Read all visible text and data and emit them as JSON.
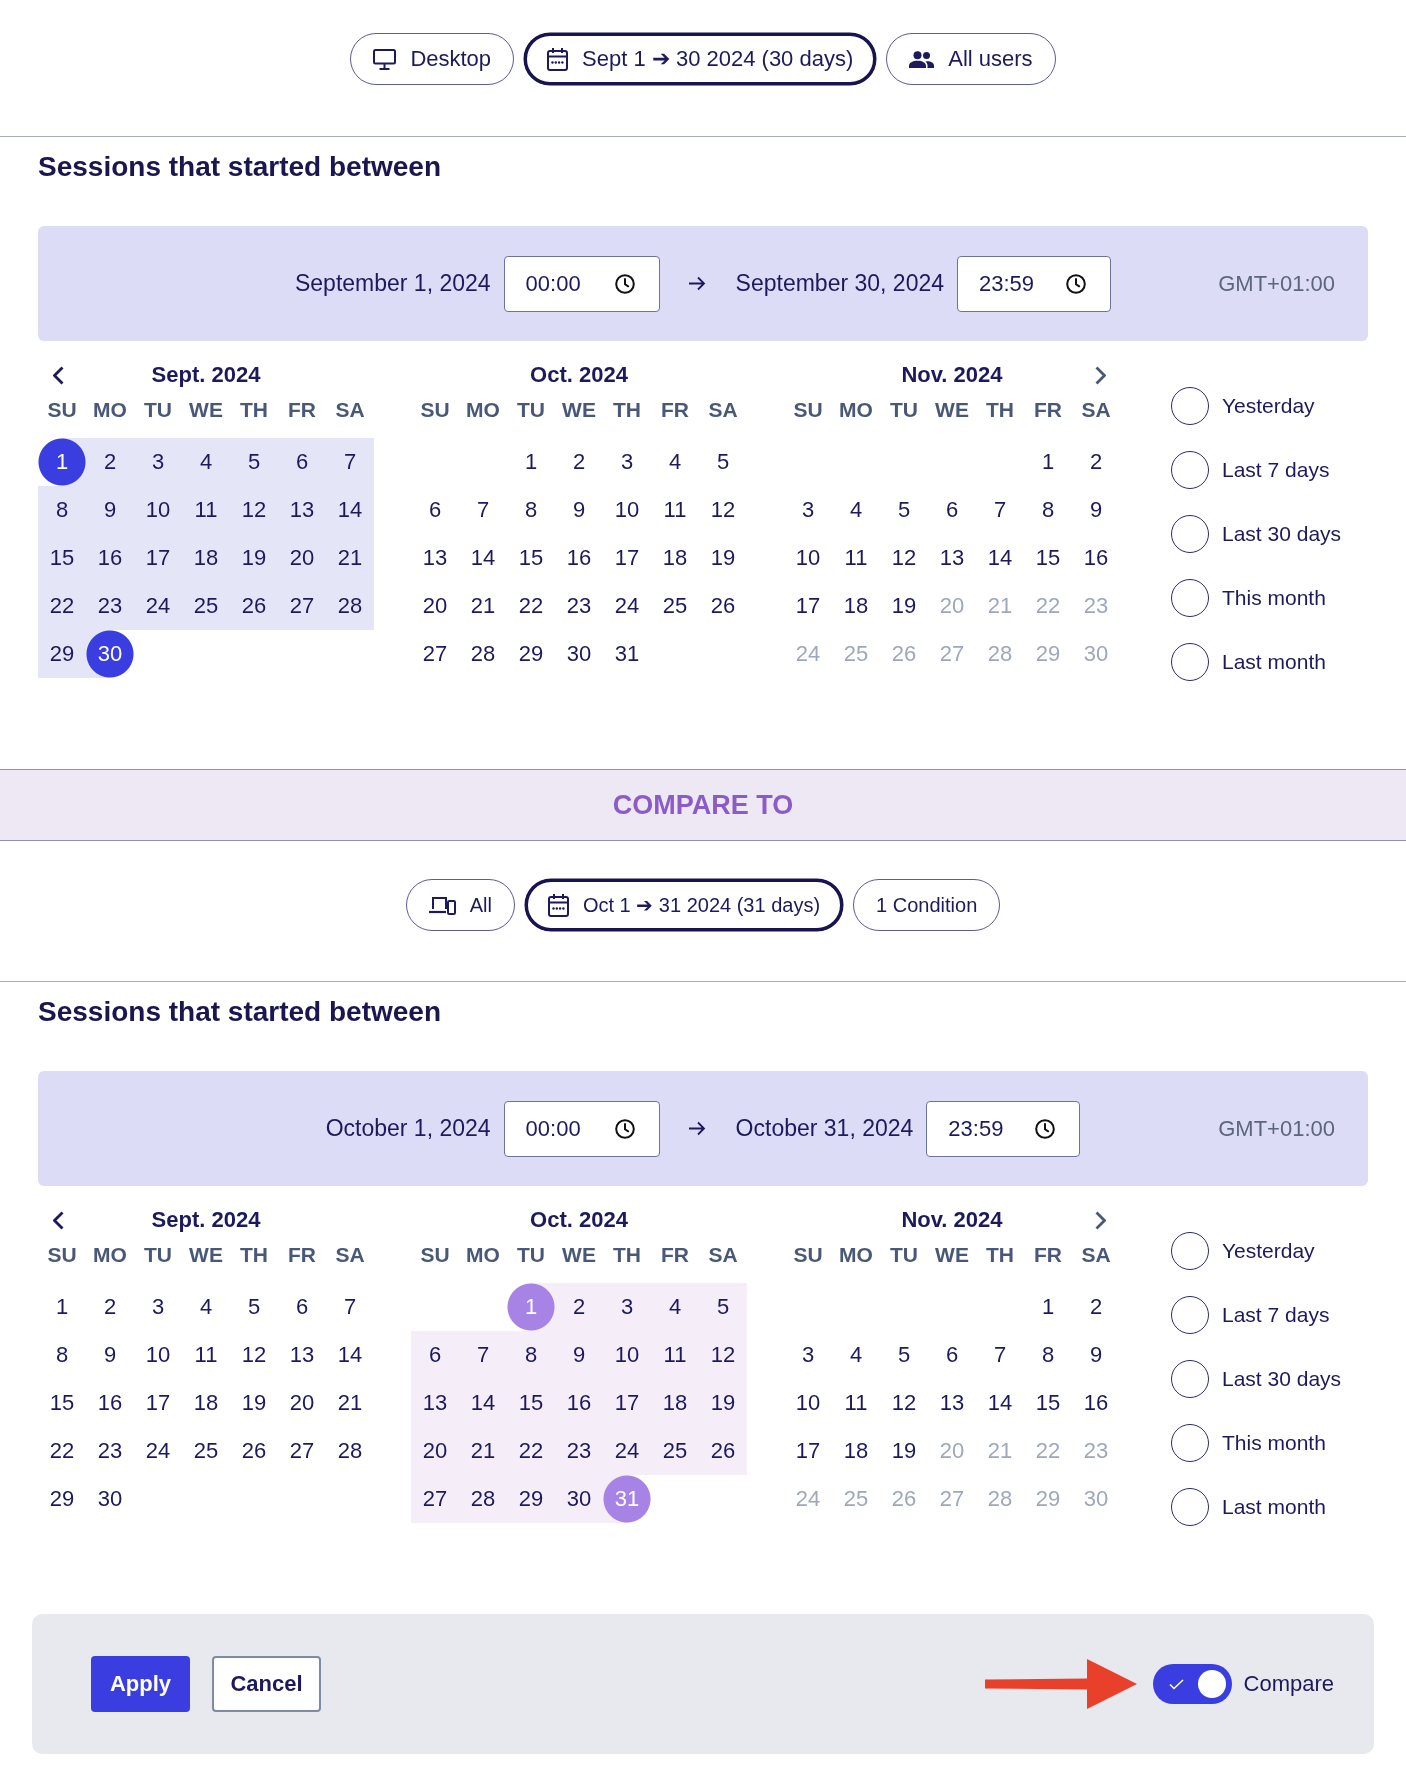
{
  "filters": [
    {
      "kind": "desktop",
      "label": "Desktop",
      "selected": false
    },
    {
      "kind": "date",
      "label": "Sept 1 ➔ 30 2024 (30 days)",
      "selected": true
    },
    {
      "kind": "users",
      "label": "All users",
      "selected": false
    }
  ],
  "period": {
    "kind": "primary",
    "heading": "Sessions that started between",
    "start_date": "September 1, 2024",
    "start_time": "00:00",
    "end_date": "September 30, 2024",
    "end_time": "23:59",
    "timezone": "GMT+01:00",
    "months": [
      {
        "title": "Sept. 2024",
        "weekdays": [
          "SU",
          "MO",
          "TU",
          "WE",
          "TH",
          "FR",
          "SA"
        ],
        "weeks": [
          [
            {
              "day": "1",
              "selected": true,
              "in_range": true,
              "disabled": false
            },
            {
              "day": "2",
              "selected": false,
              "in_range": true,
              "disabled": false
            },
            {
              "day": "3",
              "selected": false,
              "in_range": true,
              "disabled": false
            },
            {
              "day": "4",
              "selected": false,
              "in_range": true,
              "disabled": false
            },
            {
              "day": "5",
              "selected": false,
              "in_range": true,
              "disabled": false
            },
            {
              "day": "6",
              "selected": false,
              "in_range": true,
              "disabled": false
            },
            {
              "day": "7",
              "selected": false,
              "in_range": true,
              "disabled": false
            }
          ],
          [
            {
              "day": "8",
              "selected": false,
              "in_range": true,
              "disabled": false
            },
            {
              "day": "9",
              "selected": false,
              "in_range": true,
              "disabled": false
            },
            {
              "day": "10",
              "selected": false,
              "in_range": true,
              "disabled": false
            },
            {
              "day": "11",
              "selected": false,
              "in_range": true,
              "disabled": false
            },
            {
              "day": "12",
              "selected": false,
              "in_range": true,
              "disabled": false
            },
            {
              "day": "13",
              "selected": false,
              "in_range": true,
              "disabled": false
            },
            {
              "day": "14",
              "selected": false,
              "in_range": true,
              "disabled": false
            }
          ],
          [
            {
              "day": "15",
              "selected": false,
              "in_range": true,
              "disabled": false
            },
            {
              "day": "16",
              "selected": false,
              "in_range": true,
              "disabled": false
            },
            {
              "day": "17",
              "selected": false,
              "in_range": true,
              "disabled": false
            },
            {
              "day": "18",
              "selected": false,
              "in_range": true,
              "disabled": false
            },
            {
              "day": "19",
              "selected": false,
              "in_range": true,
              "disabled": false
            },
            {
              "day": "20",
              "selected": false,
              "in_range": true,
              "disabled": false
            },
            {
              "day": "21",
              "selected": false,
              "in_range": true,
              "disabled": false
            }
          ],
          [
            {
              "day": "22",
              "selected": false,
              "in_range": true,
              "disabled": false
            },
            {
              "day": "23",
              "selected": false,
              "in_range": true,
              "disabled": false
            },
            {
              "day": "24",
              "selected": false,
              "in_range": true,
              "disabled": false
            },
            {
              "day": "25",
              "selected": false,
              "in_range": true,
              "disabled": false
            },
            {
              "day": "26",
              "selected": false,
              "in_range": true,
              "disabled": false
            },
            {
              "day": "27",
              "selected": false,
              "in_range": true,
              "disabled": false
            },
            {
              "day": "28",
              "selected": false,
              "in_range": true,
              "disabled": false
            }
          ],
          [
            {
              "day": "29",
              "selected": false,
              "in_range": true,
              "disabled": false
            },
            {
              "day": "30",
              "selected": true,
              "in_range": true,
              "disabled": false
            }
          ]
        ]
      },
      {
        "title": "Oct. 2024",
        "weekdays": [
          "SU",
          "MO",
          "TU",
          "WE",
          "TH",
          "FR",
          "SA"
        ],
        "weeks": [
          [
            {
              "day": "1",
              "selected": false,
              "in_range": false,
              "disabled": false
            },
            {
              "day": "2",
              "selected": false,
              "in_range": false,
              "disabled": false
            },
            {
              "day": "3",
              "selected": false,
              "in_range": false,
              "disabled": false
            },
            {
              "day": "4",
              "selected": false,
              "in_range": false,
              "disabled": false
            },
            {
              "day": "5",
              "selected": false,
              "in_range": false,
              "disabled": false
            }
          ],
          [
            {
              "day": "6",
              "selected": false,
              "in_range": false,
              "disabled": false
            },
            {
              "day": "7",
              "selected": false,
              "in_range": false,
              "disabled": false
            },
            {
              "day": "8",
              "selected": false,
              "in_range": false,
              "disabled": false
            },
            {
              "day": "9",
              "selected": false,
              "in_range": false,
              "disabled": false
            },
            {
              "day": "10",
              "selected": false,
              "in_range": false,
              "disabled": false
            },
            {
              "day": "11",
              "selected": false,
              "in_range": false,
              "disabled": false
            },
            {
              "day": "12",
              "selected": false,
              "in_range": false,
              "disabled": false
            }
          ],
          [
            {
              "day": "13",
              "selected": false,
              "in_range": false,
              "disabled": false
            },
            {
              "day": "14",
              "selected": false,
              "in_range": false,
              "disabled": false
            },
            {
              "day": "15",
              "selected": false,
              "in_range": false,
              "disabled": false
            },
            {
              "day": "16",
              "selected": false,
              "in_range": false,
              "disabled": false
            },
            {
              "day": "17",
              "selected": false,
              "in_range": false,
              "disabled": false
            },
            {
              "day": "18",
              "selected": false,
              "in_range": false,
              "disabled": false
            },
            {
              "day": "19",
              "selected": false,
              "in_range": false,
              "disabled": false
            }
          ],
          [
            {
              "day": "20",
              "selected": false,
              "in_range": false,
              "disabled": false
            },
            {
              "day": "21",
              "selected": false,
              "in_range": false,
              "disabled": false
            },
            {
              "day": "22",
              "selected": false,
              "in_range": false,
              "disabled": false
            },
            {
              "day": "23",
              "selected": false,
              "in_range": false,
              "disabled": false
            },
            {
              "day": "24",
              "selected": false,
              "in_range": false,
              "disabled": false
            },
            {
              "day": "25",
              "selected": false,
              "in_range": false,
              "disabled": false
            },
            {
              "day": "26",
              "selected": false,
              "in_range": false,
              "disabled": false
            }
          ],
          [
            {
              "day": "27",
              "selected": false,
              "in_range": false,
              "disabled": false
            },
            {
              "day": "28",
              "selected": false,
              "in_range": false,
              "disabled": false
            },
            {
              "day": "29",
              "selected": false,
              "in_range": false,
              "disabled": false
            },
            {
              "day": "30",
              "selected": false,
              "in_range": false,
              "disabled": false
            },
            {
              "day": "31",
              "selected": false,
              "in_range": false,
              "disabled": false
            }
          ]
        ]
      },
      {
        "title": "Nov. 2024",
        "weekdays": [
          "SU",
          "MO",
          "TU",
          "WE",
          "TH",
          "FR",
          "SA"
        ],
        "weeks": [
          [
            {
              "day": "1",
              "selected": false,
              "in_range": false,
              "disabled": false
            },
            {
              "day": "2",
              "selected": false,
              "in_range": false,
              "disabled": false
            }
          ],
          [
            {
              "day": "3",
              "selected": false,
              "in_range": false,
              "disabled": false
            },
            {
              "day": "4",
              "selected": false,
              "in_range": false,
              "disabled": false
            },
            {
              "day": "5",
              "selected": false,
              "in_range": false,
              "disabled": false
            },
            {
              "day": "6",
              "selected": false,
              "in_range": false,
              "disabled": false
            },
            {
              "day": "7",
              "selected": false,
              "in_range": false,
              "disabled": false
            },
            {
              "day": "8",
              "selected": false,
              "in_range": false,
              "disabled": false
            },
            {
              "day": "9",
              "selected": false,
              "in_range": false,
              "disabled": false
            }
          ],
          [
            {
              "day": "10",
              "selected": false,
              "in_range": false,
              "disabled": false
            },
            {
              "day": "11",
              "selected": false,
              "in_range": false,
              "disabled": false
            },
            {
              "day": "12",
              "selected": false,
              "in_range": false,
              "disabled": false
            },
            {
              "day": "13",
              "selected": false,
              "in_range": false,
              "disabled": false
            },
            {
              "day": "14",
              "selected": false,
              "in_range": false,
              "disabled": false
            },
            {
              "day": "15",
              "selected": false,
              "in_range": false,
              "disabled": false
            },
            {
              "day": "16",
              "selected": false,
              "in_range": false,
              "disabled": false
            }
          ],
          [
            {
              "day": "17",
              "selected": false,
              "in_range": false,
              "disabled": false
            },
            {
              "day": "18",
              "selected": false,
              "in_range": false,
              "disabled": false
            },
            {
              "day": "19",
              "selected": false,
              "in_range": false,
              "disabled": false
            },
            {
              "day": "20",
              "selected": false,
              "in_range": false,
              "disabled": true
            },
            {
              "day": "21",
              "selected": false,
              "in_range": false,
              "disabled": true
            },
            {
              "day": "22",
              "selected": false,
              "in_range": false,
              "disabled": true
            },
            {
              "day": "23",
              "selected": false,
              "in_range": false,
              "disabled": true
            }
          ],
          [
            {
              "day": "24",
              "selected": false,
              "in_range": false,
              "disabled": true
            },
            {
              "day": "25",
              "selected": false,
              "in_range": false,
              "disabled": true
            },
            {
              "day": "26",
              "selected": false,
              "in_range": false,
              "disabled": true
            },
            {
              "day": "27",
              "selected": false,
              "in_range": false,
              "disabled": true
            },
            {
              "day": "28",
              "selected": false,
              "in_range": false,
              "disabled": true
            },
            {
              "day": "29",
              "selected": false,
              "in_range": false,
              "disabled": true
            },
            {
              "day": "30",
              "selected": false,
              "in_range": false,
              "disabled": true
            }
          ]
        ]
      }
    ],
    "presets": [
      {
        "label": "Yesterday",
        "selected": false
      },
      {
        "label": "Last 7 days",
        "selected": false
      },
      {
        "label": "Last 30 days",
        "selected": false
      },
      {
        "label": "This month",
        "selected": false
      },
      {
        "label": "Last month",
        "selected": false
      }
    ]
  },
  "compare_banner": {
    "title": "COMPARE TO"
  },
  "compare_filters": [
    {
      "kind": "devices",
      "label": "All",
      "selected": false
    },
    {
      "kind": "date",
      "label": "Oct 1 ➔ 31 2024 (31 days)",
      "selected": true
    },
    {
      "kind": "condition",
      "label": "1 Condition",
      "selected": false
    }
  ],
  "compare_period": {
    "kind": "compare",
    "heading": "Sessions that started between",
    "start_date": "October 1, 2024",
    "start_time": "00:00",
    "end_date": "October 31, 2024",
    "end_time": "23:59",
    "timezone": "GMT+01:00",
    "months": [
      {
        "title": "Sept. 2024",
        "weekdays": [
          "SU",
          "MO",
          "TU",
          "WE",
          "TH",
          "FR",
          "SA"
        ],
        "weeks": [
          [
            {
              "day": "1",
              "selected": false,
              "in_range": false,
              "disabled": false
            },
            {
              "day": "2",
              "selected": false,
              "in_range": false,
              "disabled": false
            },
            {
              "day": "3",
              "selected": false,
              "in_range": false,
              "disabled": false
            },
            {
              "day": "4",
              "selected": false,
              "in_range": false,
              "disabled": false
            },
            {
              "day": "5",
              "selected": false,
              "in_range": false,
              "disabled": false
            },
            {
              "day": "6",
              "selected": false,
              "in_range": false,
              "disabled": false
            },
            {
              "day": "7",
              "selected": false,
              "in_range": false,
              "disabled": false
            }
          ],
          [
            {
              "day": "8",
              "selected": false,
              "in_range": false,
              "disabled": false
            },
            {
              "day": "9",
              "selected": false,
              "in_range": false,
              "disabled": false
            },
            {
              "day": "10",
              "selected": false,
              "in_range": false,
              "disabled": false
            },
            {
              "day": "11",
              "selected": false,
              "in_range": false,
              "disabled": false
            },
            {
              "day": "12",
              "selected": false,
              "in_range": false,
              "disabled": false
            },
            {
              "day": "13",
              "selected": false,
              "in_range": false,
              "disabled": false
            },
            {
              "day": "14",
              "selected": false,
              "in_range": false,
              "disabled": false
            }
          ],
          [
            {
              "day": "15",
              "selected": false,
              "in_range": false,
              "disabled": false
            },
            {
              "day": "16",
              "selected": false,
              "in_range": false,
              "disabled": false
            },
            {
              "day": "17",
              "selected": false,
              "in_range": false,
              "disabled": false
            },
            {
              "day": "18",
              "selected": false,
              "in_range": false,
              "disabled": false
            },
            {
              "day": "19",
              "selected": false,
              "in_range": false,
              "disabled": false
            },
            {
              "day": "20",
              "selected": false,
              "in_range": false,
              "disabled": false
            },
            {
              "day": "21",
              "selected": false,
              "in_range": false,
              "disabled": false
            }
          ],
          [
            {
              "day": "22",
              "selected": false,
              "in_range": false,
              "disabled": false
            },
            {
              "day": "23",
              "selected": false,
              "in_range": false,
              "disabled": false
            },
            {
              "day": "24",
              "selected": false,
              "in_range": false,
              "disabled": false
            },
            {
              "day": "25",
              "selected": false,
              "in_range": false,
              "disabled": false
            },
            {
              "day": "26",
              "selected": false,
              "in_range": false,
              "disabled": false
            },
            {
              "day": "27",
              "selected": false,
              "in_range": false,
              "disabled": false
            },
            {
              "day": "28",
              "selected": false,
              "in_range": false,
              "disabled": false
            }
          ],
          [
            {
              "day": "29",
              "selected": false,
              "in_range": false,
              "disabled": false
            },
            {
              "day": "30",
              "selected": false,
              "in_range": false,
              "disabled": false
            }
          ]
        ]
      },
      {
        "title": "Oct. 2024",
        "weekdays": [
          "SU",
          "MO",
          "TU",
          "WE",
          "TH",
          "FR",
          "SA"
        ],
        "weeks": [
          [
            {
              "day": "1",
              "selected": true,
              "in_range": true,
              "disabled": false
            },
            {
              "day": "2",
              "selected": false,
              "in_range": true,
              "disabled": false
            },
            {
              "day": "3",
              "selected": false,
              "in_range": true,
              "disabled": false
            },
            {
              "day": "4",
              "selected": false,
              "in_range": true,
              "disabled": false
            },
            {
              "day": "5",
              "selected": false,
              "in_range": true,
              "disabled": false
            }
          ],
          [
            {
              "day": "6",
              "selected": false,
              "in_range": true,
              "disabled": false
            },
            {
              "day": "7",
              "selected": false,
              "in_range": true,
              "disabled": false
            },
            {
              "day": "8",
              "selected": false,
              "in_range": true,
              "disabled": false
            },
            {
              "day": "9",
              "selected": false,
              "in_range": true,
              "disabled": false
            },
            {
              "day": "10",
              "selected": false,
              "in_range": true,
              "disabled": false
            },
            {
              "day": "11",
              "selected": false,
              "in_range": true,
              "disabled": false
            },
            {
              "day": "12",
              "selected": false,
              "in_range": true,
              "disabled": false
            }
          ],
          [
            {
              "day": "13",
              "selected": false,
              "in_range": true,
              "disabled": false
            },
            {
              "day": "14",
              "selected": false,
              "in_range": true,
              "disabled": false
            },
            {
              "day": "15",
              "selected": false,
              "in_range": true,
              "disabled": false
            },
            {
              "day": "16",
              "selected": false,
              "in_range": true,
              "disabled": false
            },
            {
              "day": "17",
              "selected": false,
              "in_range": true,
              "disabled": false
            },
            {
              "day": "18",
              "selected": false,
              "in_range": true,
              "disabled": false
            },
            {
              "day": "19",
              "selected": false,
              "in_range": true,
              "disabled": false
            }
          ],
          [
            {
              "day": "20",
              "selected": false,
              "in_range": true,
              "disabled": false
            },
            {
              "day": "21",
              "selected": false,
              "in_range": true,
              "disabled": false
            },
            {
              "day": "22",
              "selected": false,
              "in_range": true,
              "disabled": false
            },
            {
              "day": "23",
              "selected": false,
              "in_range": true,
              "disabled": false
            },
            {
              "day": "24",
              "selected": false,
              "in_range": true,
              "disabled": false
            },
            {
              "day": "25",
              "selected": false,
              "in_range": true,
              "disabled": false
            },
            {
              "day": "26",
              "selected": false,
              "in_range": true,
              "disabled": false
            }
          ],
          [
            {
              "day": "27",
              "selected": false,
              "in_range": true,
              "disabled": false
            },
            {
              "day": "28",
              "selected": false,
              "in_range": true,
              "disabled": false
            },
            {
              "day": "29",
              "selected": false,
              "in_range": true,
              "disabled": false
            },
            {
              "day": "30",
              "selected": false,
              "in_range": true,
              "disabled": false
            },
            {
              "day": "31",
              "selected": true,
              "in_range": true,
              "disabled": false
            }
          ]
        ]
      },
      {
        "title": "Nov. 2024",
        "weekdays": [
          "SU",
          "MO",
          "TU",
          "WE",
          "TH",
          "FR",
          "SA"
        ],
        "weeks": [
          [
            {
              "day": "1",
              "selected": false,
              "in_range": false,
              "disabled": false
            },
            {
              "day": "2",
              "selected": false,
              "in_range": false,
              "disabled": false
            }
          ],
          [
            {
              "day": "3",
              "selected": false,
              "in_range": false,
              "disabled": false
            },
            {
              "day": "4",
              "selected": false,
              "in_range": false,
              "disabled": false
            },
            {
              "day": "5",
              "selected": false,
              "in_range": false,
              "disabled": false
            },
            {
              "day": "6",
              "selected": false,
              "in_range": false,
              "disabled": false
            },
            {
              "day": "7",
              "selected": false,
              "in_range": false,
              "disabled": false
            },
            {
              "day": "8",
              "selected": false,
              "in_range": false,
              "disabled": false
            },
            {
              "day": "9",
              "selected": false,
              "in_range": false,
              "disabled": false
            }
          ],
          [
            {
              "day": "10",
              "selected": false,
              "in_range": false,
              "disabled": false
            },
            {
              "day": "11",
              "selected": false,
              "in_range": false,
              "disabled": false
            },
            {
              "day": "12",
              "selected": false,
              "in_range": false,
              "disabled": false
            },
            {
              "day": "13",
              "selected": false,
              "in_range": false,
              "disabled": false
            },
            {
              "day": "14",
              "selected": false,
              "in_range": false,
              "disabled": false
            },
            {
              "day": "15",
              "selected": false,
              "in_range": false,
              "disabled": false
            },
            {
              "day": "16",
              "selected": false,
              "in_range": false,
              "disabled": false
            }
          ],
          [
            {
              "day": "17",
              "selected": false,
              "in_range": false,
              "disabled": false
            },
            {
              "day": "18",
              "selected": false,
              "in_range": false,
              "disabled": false
            },
            {
              "day": "19",
              "selected": false,
              "in_range": false,
              "disabled": false
            },
            {
              "day": "20",
              "selected": false,
              "in_range": false,
              "disabled": true
            },
            {
              "day": "21",
              "selected": false,
              "in_range": false,
              "disabled": true
            },
            {
              "day": "22",
              "selected": false,
              "in_range": false,
              "disabled": true
            },
            {
              "day": "23",
              "selected": false,
              "in_range": false,
              "disabled": true
            }
          ],
          [
            {
              "day": "24",
              "selected": false,
              "in_range": false,
              "disabled": true
            },
            {
              "day": "25",
              "selected": false,
              "in_range": false,
              "disabled": true
            },
            {
              "day": "26",
              "selected": false,
              "in_range": false,
              "disabled": true
            },
            {
              "day": "27",
              "selected": false,
              "in_range": false,
              "disabled": true
            },
            {
              "day": "28",
              "selected": false,
              "in_range": false,
              "disabled": true
            },
            {
              "day": "29",
              "selected": false,
              "in_range": false,
              "disabled": true
            },
            {
              "day": "30",
              "selected": false,
              "in_range": false,
              "disabled": true
            }
          ]
        ]
      }
    ],
    "presets": [
      {
        "label": "Yesterday",
        "selected": false
      },
      {
        "label": "Last 7 days",
        "selected": false
      },
      {
        "label": "Last 30 days",
        "selected": false
      },
      {
        "label": "This month",
        "selected": false
      },
      {
        "label": "Last month",
        "selected": false
      }
    ]
  },
  "footer": {
    "buttons": [
      {
        "kind": "primary",
        "label": "Apply"
      },
      {
        "kind": "secondary",
        "label": "Cancel"
      }
    ],
    "compare_toggle": {
      "label": "Compare",
      "on": true
    }
  }
}
